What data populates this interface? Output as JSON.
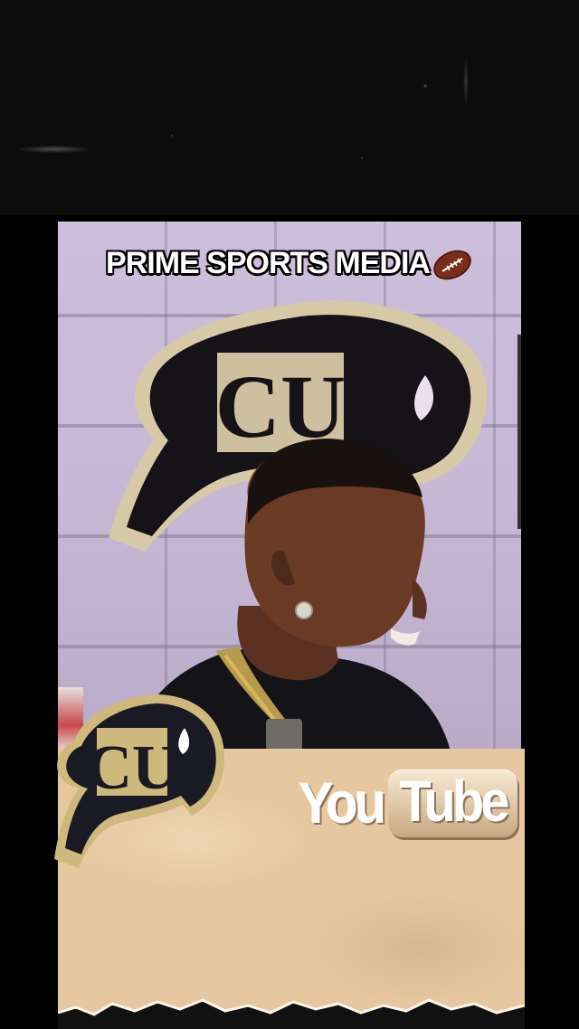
{
  "overlay": {
    "watermark_text": "PRIME SPORTS MEDIA",
    "watermark_emoji_icon": "football-icon"
  },
  "branding": {
    "youtube_you": "You",
    "youtube_tube": "Tube",
    "wall_logo": "CU",
    "sticker_logo": "CU"
  },
  "colors": {
    "background": "#000000",
    "wall": "#c7b8d6",
    "paper": "#e6c7a0",
    "cu_gold": "#cfb87c",
    "cu_black": "#1a1a24"
  }
}
